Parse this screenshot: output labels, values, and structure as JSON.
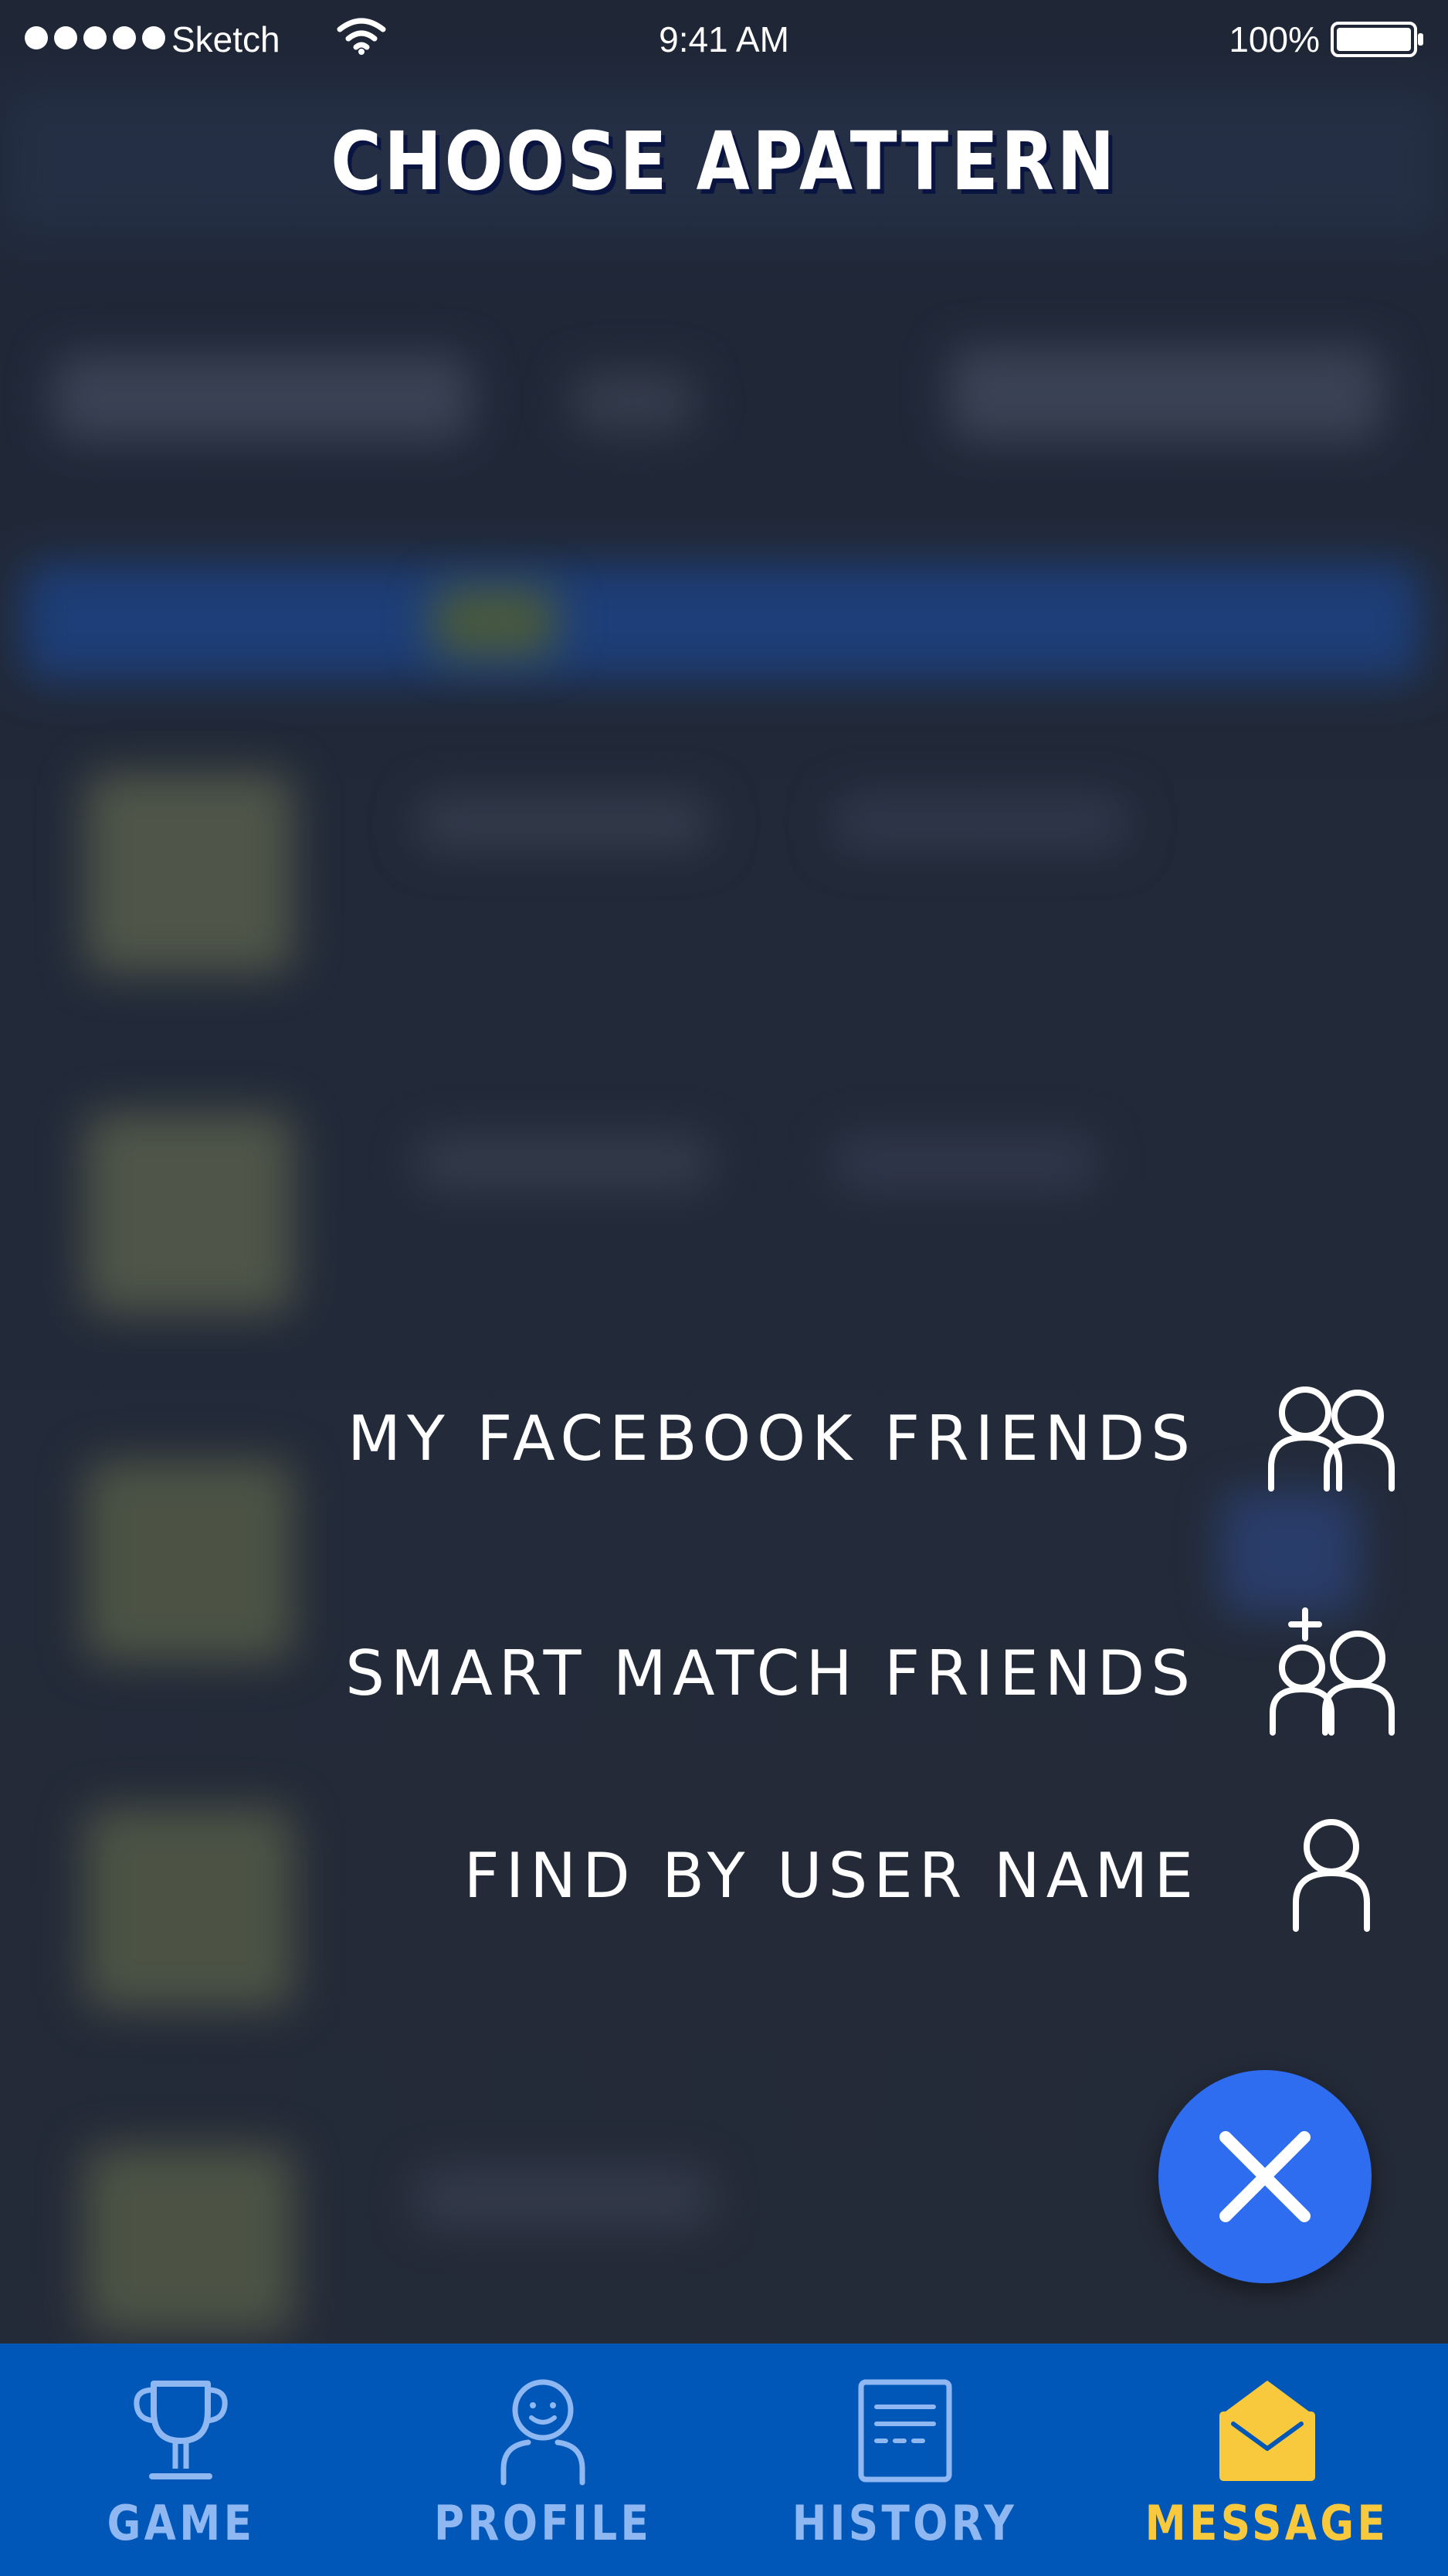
{
  "status_bar": {
    "carrier": "Sketch",
    "time": "9:41 AM",
    "battery": "100%"
  },
  "header": {
    "title": "CHOOSE APATTERN"
  },
  "menu": {
    "options": [
      {
        "label": "MY FACEBOOK FRIENDS",
        "icon": "two-people-icon"
      },
      {
        "label": "SMART MATCH FRIENDS",
        "icon": "add-friends-icon"
      },
      {
        "label": "FIND BY USER NAME",
        "icon": "person-icon"
      }
    ]
  },
  "fab": {
    "icon": "close-icon",
    "color": "#2e6cf0"
  },
  "tab_bar": {
    "background": "#0057b8",
    "inactive_color": "#8fb8f2",
    "active_color": "#f8c93c",
    "tabs": [
      {
        "label": "GAME",
        "icon": "trophy-icon",
        "active": false
      },
      {
        "label": "PROFILE",
        "icon": "profile-icon",
        "active": false
      },
      {
        "label": "HISTORY",
        "icon": "document-icon",
        "active": false
      },
      {
        "label": "MESSAGE",
        "icon": "envelope-icon",
        "active": true
      }
    ]
  }
}
